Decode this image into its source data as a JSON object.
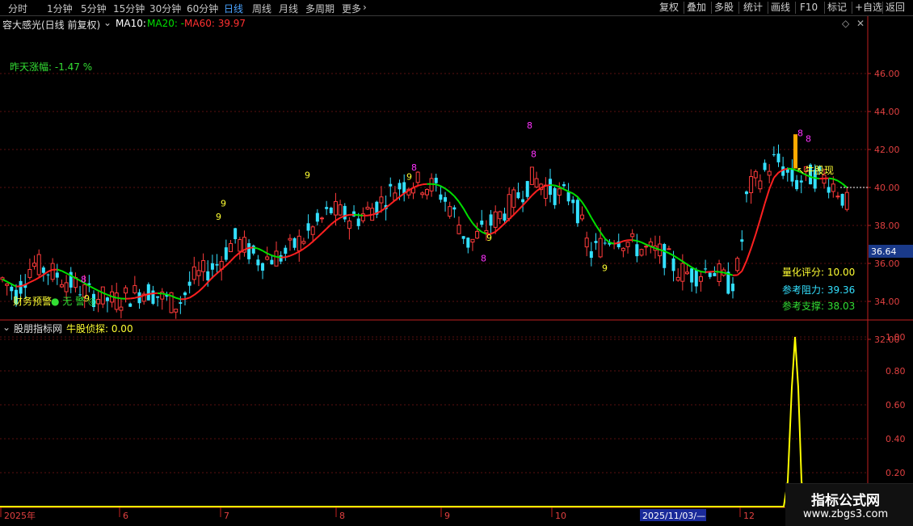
{
  "toolbar": {
    "periods": [
      {
        "label": "分时",
        "active": false
      },
      {
        "label": "1分钟",
        "active": false
      },
      {
        "label": "5分钟",
        "active": false
      },
      {
        "label": "15分钟",
        "active": false
      },
      {
        "label": "30分钟",
        "active": false
      },
      {
        "label": "60分钟",
        "active": false
      },
      {
        "label": "日线",
        "active": true
      },
      {
        "label": "周线",
        "active": false
      },
      {
        "label": "月线",
        "active": false
      },
      {
        "label": "多周期",
        "active": false
      },
      {
        "label": "更多",
        "active": false
      }
    ],
    "right_buttons": [
      "复权",
      "叠加",
      "多股",
      "统计",
      "画线",
      "F10",
      "标记",
      "+自选",
      "返回"
    ]
  },
  "stock": {
    "name": "容大感光(日线 前复权)",
    "ma10_label": "MA10:",
    "ma20_label": "MA20: -",
    "ma60_label": "MA60: 39.97",
    "yesterday_change": "昨天涨幅: -1.47 %"
  },
  "main_panel": {
    "price_axis": [
      "46.00",
      "44.00",
      "42.00",
      "40.00",
      "38.00",
      "36.00",
      "34.00",
      "32.00"
    ],
    "current_price_tag": "36.64",
    "bull_signal": "↖牛股现",
    "score_label": "量化评分: 10.00",
    "resistance_label": "参考阻力: 39.36",
    "support_label": "参考支撑: 38.03",
    "finance_warning_prefix": "财务预警:",
    "finance_warning_value": "无 警",
    "td_counts": [
      "9",
      "8",
      "9",
      "9",
      "8",
      "9",
      "8",
      "9",
      "8",
      "9",
      "8",
      "8",
      "8",
      "9"
    ]
  },
  "indicator_panel": {
    "source": "股朋指标网",
    "name_value": "牛股侦探: 0.00",
    "axis": [
      "1.00",
      "0.80",
      "0.60",
      "0.40",
      "0.20"
    ]
  },
  "time_axis": {
    "labels": [
      "2025年",
      "6",
      "7",
      "8",
      "9",
      "10",
      "12"
    ],
    "cursor_date": "2025/11/03/—"
  },
  "watermark": {
    "line1": "指标公式网",
    "line2": "www.zbgs3.com"
  },
  "colors": {
    "up": "#ff3b3b",
    "down": "#33e0ff",
    "ma10": "#ffffff",
    "ma20": "#00e000",
    "ma60": "#ff2020",
    "indicator": "#ffff00",
    "active_tab": "#4aa3ff"
  }
}
